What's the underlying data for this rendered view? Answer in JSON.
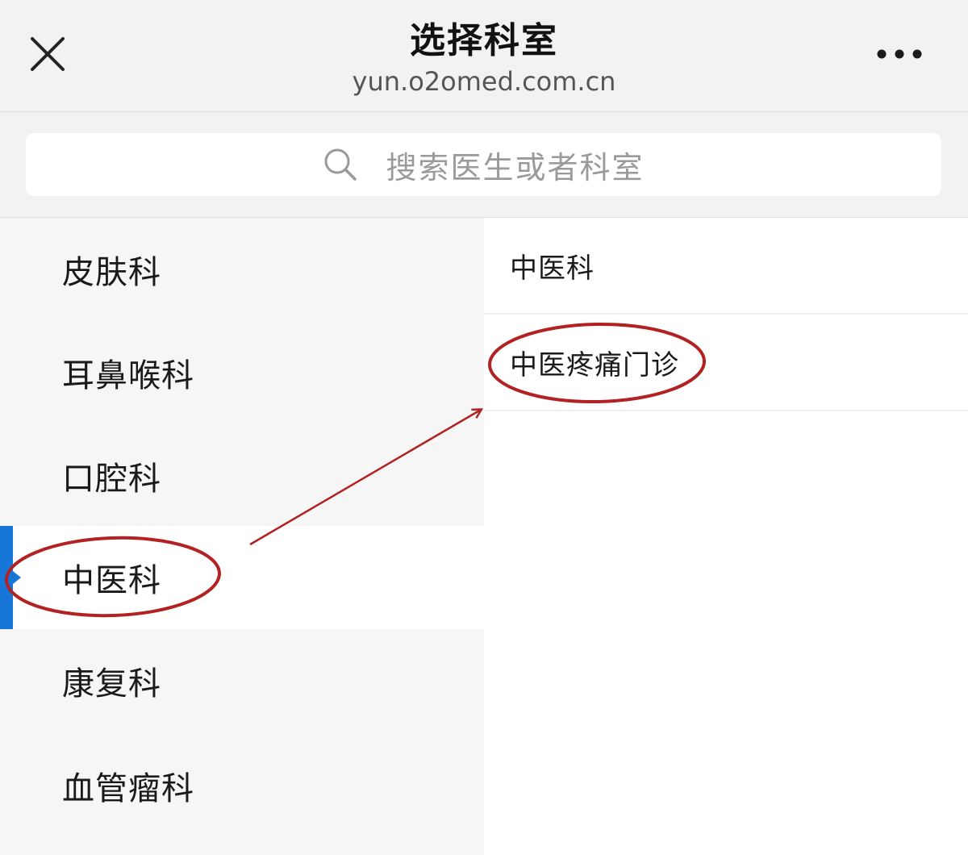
{
  "header": {
    "title": "选择科室",
    "url": "yun.o2omed.com.cn",
    "close_icon": "close-icon",
    "more_icon": "more-dots-icon"
  },
  "search": {
    "placeholder": "搜索医生或者科室",
    "icon": "search-icon"
  },
  "departments": [
    {
      "label": "皮肤科",
      "active": false
    },
    {
      "label": "耳鼻喉科",
      "active": false
    },
    {
      "label": "口腔科",
      "active": false
    },
    {
      "label": "中医科",
      "active": true
    },
    {
      "label": "康复科",
      "active": false
    },
    {
      "label": "血管瘤科",
      "active": false
    }
  ],
  "clinics": [
    {
      "label": "中医科"
    },
    {
      "label": "中医疼痛门诊"
    }
  ],
  "colors": {
    "accent": "#1677d8",
    "annotation": "#b22222",
    "header_bg": "#f2f2f2",
    "sidebar_bg": "#f6f6f6"
  }
}
